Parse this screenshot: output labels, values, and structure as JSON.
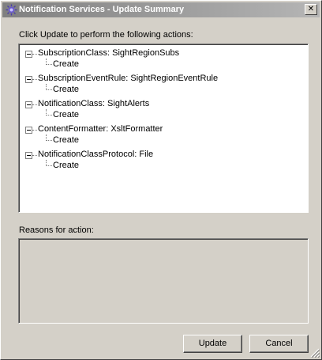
{
  "window": {
    "title": "Notification Services - Update Summary",
    "close_label": "✕"
  },
  "instruction": "Click Update to perform the following actions:",
  "tree": {
    "items": [
      {
        "label": "SubscriptionClass: SightRegionSubs",
        "child": "Create"
      },
      {
        "label": "SubscriptionEventRule: SightRegionEventRule",
        "child": "Create"
      },
      {
        "label": "NotificationClass: SightAlerts",
        "child": "Create"
      },
      {
        "label": "ContentFormatter: XsltFormatter",
        "child": "Create"
      },
      {
        "label": "NotificationClassProtocol: File",
        "child": "Create"
      }
    ]
  },
  "reasons": {
    "label": "Reasons for action:",
    "text": ""
  },
  "buttons": {
    "update": "Update",
    "cancel": "Cancel"
  }
}
